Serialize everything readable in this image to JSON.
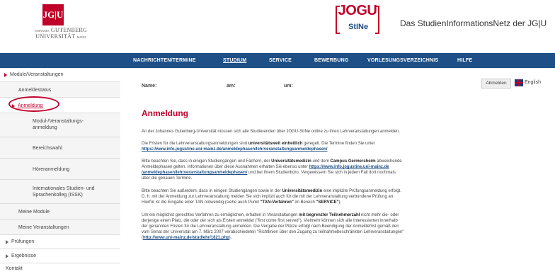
{
  "header": {
    "jgu_mark": "JG|U",
    "jgu_line1": "GUTENBERG",
    "jgu_line2": "UNIVERSITÄT",
    "jgu_prefix": "JOHANNES",
    "jgu_suffix": "MAINZ",
    "jogu_word": "JOGU",
    "jogu_stine": "StINe",
    "tagline": "Das StudienInformationsNetz der JG|U"
  },
  "nav": {
    "items": [
      "NACHRICHTEN/TERMINE",
      "STUDIUM",
      "SERVICE",
      "BEWERBUNG",
      "VORLESUNGSVERZEICHNIS",
      "HILFE"
    ],
    "active": "STUDIUM"
  },
  "sidebar": {
    "section": "Module/Veranstaltungen",
    "items": [
      "Anmeldestatus",
      "Anmeldung",
      "Modul-/Veranstaltungs-",
      "anmeldung",
      "Bereichswahl",
      "Höreranmeldung",
      "Internationales Studien- und",
      "Sprachenkolleg (ISSK)",
      "Meine Module",
      "Meine Veranstaltungen",
      "Prüfungen",
      "Ergebnisse",
      "Kontakt"
    ]
  },
  "main": {
    "name_label": "Name:",
    "am_label": "am:",
    "um_label": "um:",
    "abmelden_label": "Abmelden",
    "english_label": "English",
    "title": "Anmeldung",
    "p1": "An der Johannes Gutenberg-Universität müssen sich alle Studierenden über JOGU-StINe online zu ihren Lehrveranstaltungen anmelden.",
    "p2a": "Die Fristen für die Lehrveranstaltungsanmeldungen sind ",
    "p2b": "universitätsweit einheitlich",
    "p2c": " geregelt. Die Termine finden Sie unter",
    "p2link": "https://www.info.jogustine.uni-mainz.de/anmeldephasen/lehrveranstaltungsanmeldephasen/",
    "p3a": "Bitte beachten Sie, dass in einigen Studiengängen und Fächern, der ",
    "p3b": "Universitätsmedizin",
    "p3c": " und dem ",
    "p3d": "Campus Germersheim",
    "p3e": " abweichende",
    "p3f": "Anmeldephasen gelten. Informationen über diese Ausnahmen erhalten Sie ebenso unter ",
    "p3link1": "https://www.info.jogustine.uni-mainz.de",
    "p3link2": "/anmeldephasen/lehrveranstaltungsanmeldephasen/",
    "p3g": " und bei Ihrem Studienbüro. Vergewissern Sie sich in jedem Fall dort nochmals",
    "p3h": "über die genauen Termine.",
    "p4a": "Bitte beachten Sie außerdem, dass in einigen Studiengängen sowie in der ",
    "p4b": "Universitätsmedizin",
    "p4c": " eine implizite Prüfungsanmeldung erfolgt.",
    "p4d": "D. h. mit der Anmeldung zur Lehrveranstaltung melden Sie sich implizit auch für die mit der Lehrveranstaltung verbundene Prüfung an.",
    "p4e": "Hierfür ist die Eingabe einer TAN notwendig (siehe auch Punkt ",
    "p4f": "\"TAN-Verfahren\"",
    "p4g": " im Bereich ",
    "p4h": "\"SERVICE\"",
    "p4i": ").",
    "p5a": "Um ein möglichst gerechtes Verfahren zu ermöglichen, erhalten in Veranstaltungen ",
    "p5b": "mit begrenzter Teilnehmerzahl",
    "p5c": " nicht mehr die- oder",
    "p5d": "derjenige einen Platz, die oder der sich als Erste/r anmeldet (\"first come first served\"). Vielmehr können sich alle Interessierten innerhalb",
    "p5e": "der genannten Fristen für die Lehrveranstaltung anmelden. Die Vergabe der Plätze erfolgt nach Beendigung der Anmeldefrist gemäß den",
    "p5f": "vom Senat der Universität am 7. März 2007 verabschiedeten \"Richtlinien über den Zugang zu teilnahmebeschränkten Lehrveranstaltungen\"",
    "p5link": "http://www.uni-mainz.de/studlehr/1821.php",
    "p5g": ")."
  }
}
